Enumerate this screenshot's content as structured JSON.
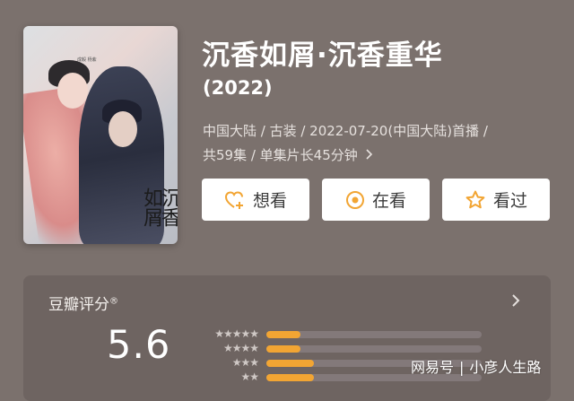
{
  "header": {
    "title": "沉香如屑·沉香重华",
    "year": "(2022)",
    "meta_line1": "中国大陆 / 古装 / 2022-07-20(中国大陆)首播 /",
    "meta_line2": "共59集 / 单集片长45分钟"
  },
  "poster": {
    "calligraphy": "沉香如屑",
    "small_text": "成毅 杨紫"
  },
  "actions": {
    "want_label": "想看",
    "watching_label": "在看",
    "watched_label": "看过"
  },
  "rating": {
    "section_title": "豆瓣评分",
    "registered_mark": "®",
    "score": "5.6",
    "distribution": [
      {
        "stars": "★★★★★",
        "fraction": 0.16
      },
      {
        "stars": "★★★★",
        "fraction": 0.16
      },
      {
        "stars": "★★★",
        "fraction": 0.22
      },
      {
        "stars": "★★",
        "fraction": 0.22
      }
    ]
  },
  "watermark": {
    "brand": "网易号",
    "author": "小彦人生路"
  },
  "colors": {
    "background": "#7b716d",
    "panel": "#6e6461",
    "accent_orange": "#f2a533"
  }
}
